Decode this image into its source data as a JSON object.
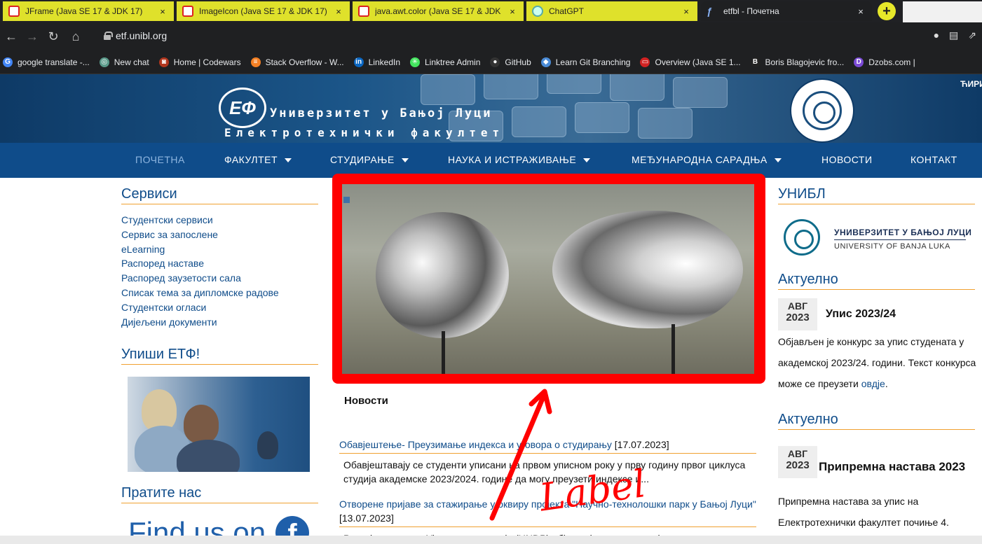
{
  "browser": {
    "tabs": [
      {
        "label": "JFrame (Java SE 17 & JDK 17)",
        "icon": "oracle-icon"
      },
      {
        "label": "ImageIcon (Java SE 17 & JDK 17)",
        "icon": "oracle-icon"
      },
      {
        "label": "java.awt.color (Java SE 17 & JDK",
        "icon": "oracle-icon"
      },
      {
        "label": "ChatGPT",
        "icon": "chatgpt-icon"
      },
      {
        "label": "etfbl - Почетна",
        "icon": "etf-icon",
        "active": true
      }
    ],
    "tab_close": "×",
    "new_tab": "+",
    "url": "etf.unibl.org",
    "bookmarks": [
      {
        "label": "google translate -...",
        "color": "#4285f4",
        "glyph": "G"
      },
      {
        "label": "New chat",
        "color": "#5a9a8a",
        "glyph": "◎"
      },
      {
        "label": "Home | Codewars",
        "color": "#b1361e",
        "glyph": "◙"
      },
      {
        "label": "Stack Overflow - W...",
        "color": "#f48024",
        "glyph": "≡"
      },
      {
        "label": "LinkedIn",
        "color": "#0a66c2",
        "glyph": "in"
      },
      {
        "label": "Linktree Admin",
        "color": "#43e55e",
        "glyph": "✳"
      },
      {
        "label": "GitHub",
        "color": "#333333",
        "glyph": "●"
      },
      {
        "label": "Learn Git Branching",
        "color": "#4a8bd6",
        "glyph": "◆"
      },
      {
        "label": "Overview (Java SE 1...",
        "color": "#d22222",
        "glyph": "▭"
      },
      {
        "label": "Boris Blagojevic fro...",
        "color": "#222222",
        "glyph": "B"
      },
      {
        "label": "Dzobs.com |",
        "color": "#7b4ad6",
        "glyph": "D"
      }
    ]
  },
  "site": {
    "uni_title": "Универзитет у Бањој Луци",
    "faculty_title": "Електротехнички факултет",
    "script_toggle": "ЋИРИ",
    "nav": [
      {
        "label": "ПОЧЕТНА",
        "dropdown": false,
        "active": true
      },
      {
        "label": "ФАКУЛТЕТ",
        "dropdown": true
      },
      {
        "label": "СТУДИРАЊЕ",
        "dropdown": true
      },
      {
        "label": "НАУКА И ИСТРАЖИВАЊЕ",
        "dropdown": true
      },
      {
        "label": "МЕЂУНАРОДНА САРАДЊА",
        "dropdown": true
      },
      {
        "label": "НОВОСТИ",
        "dropdown": false
      },
      {
        "label": "КОНТАКТ",
        "dropdown": false
      }
    ]
  },
  "left": {
    "services_heading": "Сервиси",
    "services": [
      "Студентски сервиси",
      "Сервис за запослене",
      "eLearning",
      "Распоред наставе",
      "Распоред заузетости сала",
      "Списак тема за дипломске радове",
      "Студентски огласи",
      "Дијељени документи"
    ],
    "enroll_heading": "Упиши ЕТФ!",
    "follow_heading": "Пратите нас",
    "facebook_text": "Find us on",
    "facebook_glyph": "f"
  },
  "center": {
    "annotation_label": "Label",
    "news_heading": "Новости",
    "news": [
      {
        "title": "Обавјештење- Преузимање индекса и уговора о студирању",
        "date": "[17.07.2023]",
        "snippet": "Обавјештавају се студенти уписани на првом уписном року у прву годину првог циклуса студија академске 2023/2024. године да могу преузети индексе и..."
      },
      {
        "title": "Отворене пријаве за стажирање у оквиру пројекта \"Научно-технолошки парк у Бањој Луци\"",
        "date": "[13.07.2023]",
        "snippet": "Развојни програм Уједињених нација (UNDP) објавио је позив за пријаву..."
      }
    ]
  },
  "right": {
    "unibl_heading": "УНИБЛ",
    "unibl_name": "УНИВЕРЗИТЕТ У БАЊОЈ ЛУЦИ",
    "unibl_sub": "UNIVERSITY OF BANJA LUKA",
    "current": [
      {
        "heading": "Актуелно",
        "month": "АВГ",
        "year": "2023",
        "title": "Упис 2023/24",
        "text": "Објављен је конкурс за упис студената у академској 2023/24. години. Текст конкурса може се преузети",
        "link": "овдје",
        "after_link": "."
      },
      {
        "heading": "Актуелно",
        "month": "АВГ",
        "year": "2023",
        "title": "Припремна настава 2023",
        "text": "Припремна настава за упис на Електротехнички факултет почиње 4."
      }
    ]
  },
  "colors": {
    "tab_yellow": "#dfe12b",
    "nav_blue": "#0f4c8a",
    "accent_orange": "#f0a030",
    "annotation_red": "#ff0000"
  }
}
